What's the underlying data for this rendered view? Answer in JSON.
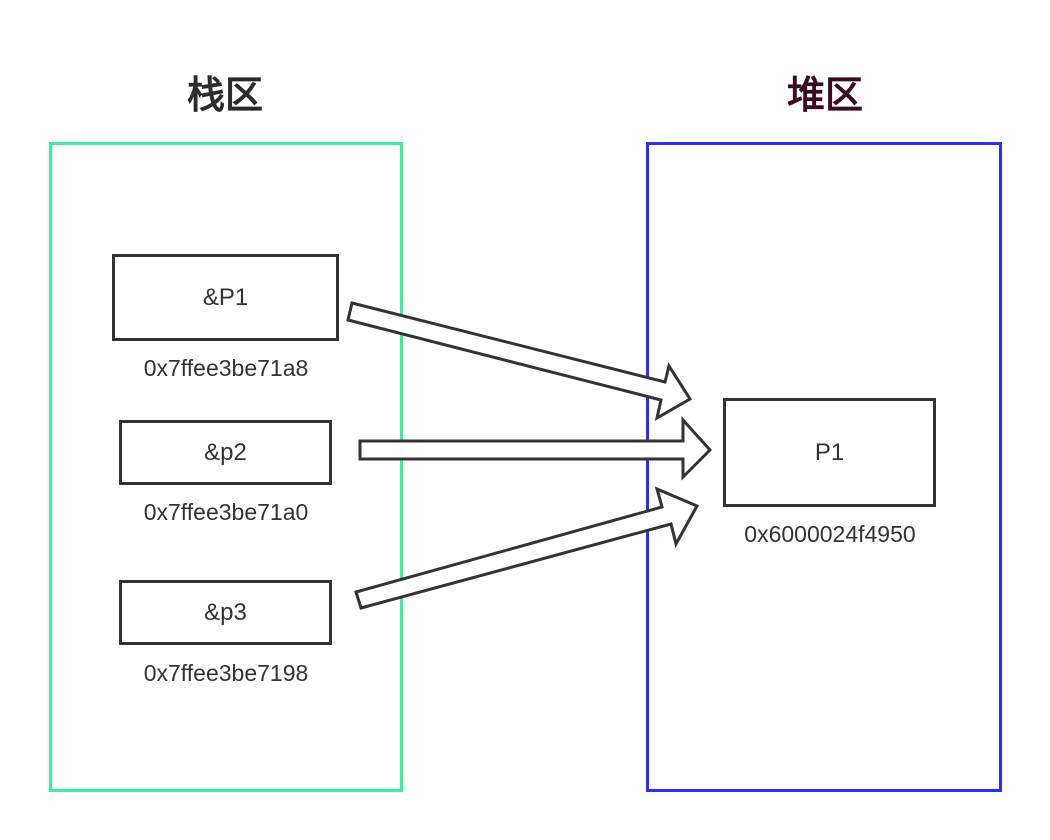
{
  "stack": {
    "title": "栈区",
    "border_color": "#3df09a",
    "variables": [
      {
        "label": "&P1",
        "address": "0x7ffee3be71a8"
      },
      {
        "label": "&p2",
        "address": "0x7ffee3be71a0"
      },
      {
        "label": "&p3",
        "address": "0x7ffee3be7198"
      }
    ]
  },
  "heap": {
    "title": "堆区",
    "border_color": "#2b2ff0",
    "object": {
      "label": "P1",
      "address": "0x6000024f4950"
    }
  }
}
